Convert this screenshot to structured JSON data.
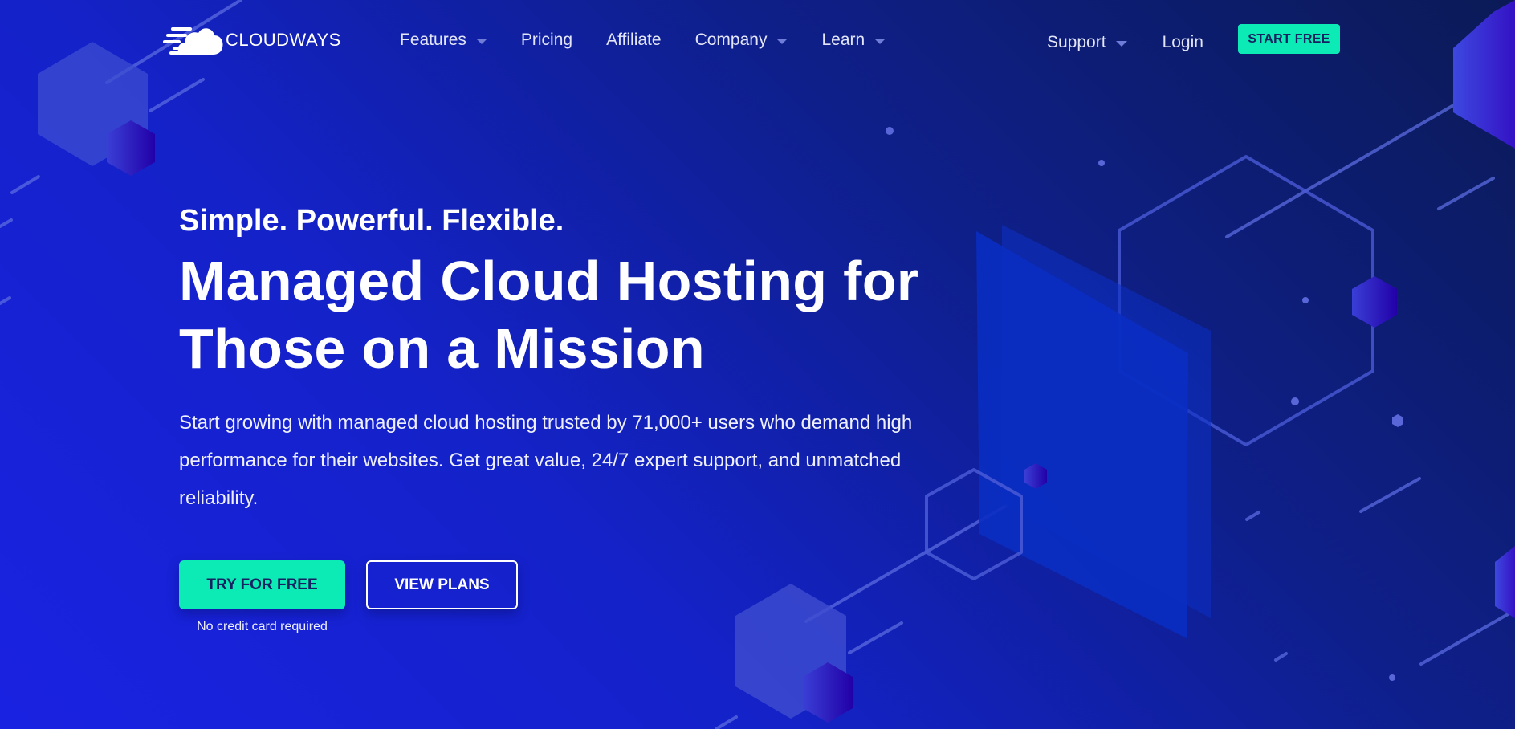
{
  "brand": {
    "name": "CLOUDWAYS",
    "logo_icon": "cloud-speed-icon"
  },
  "nav": {
    "left": [
      {
        "label": "Features",
        "has_dropdown": true
      },
      {
        "label": "Pricing",
        "has_dropdown": false
      },
      {
        "label": "Affiliate",
        "has_dropdown": false
      },
      {
        "label": "Company",
        "has_dropdown": true
      },
      {
        "label": "Learn",
        "has_dropdown": true
      }
    ],
    "right": [
      {
        "label": "Support",
        "has_dropdown": true
      },
      {
        "label": "Login",
        "has_dropdown": false
      }
    ],
    "start_free_label": "START FREE"
  },
  "hero": {
    "tagline": "Simple. Powerful. Flexible.",
    "headline_line1": "Managed Cloud Hosting for",
    "headline_line2": "Those on a Mission",
    "description": "Start growing with managed cloud hosting trusted by 71,000+ users who demand high performance for their websites. Get great value, 24/7 expert support, and unmatched reliability.",
    "primary_cta": "TRY FOR FREE",
    "secondary_cta": "VIEW PLANS",
    "note": "No credit card required"
  },
  "colors": {
    "accent": "#0ceab5",
    "accent_text": "#172161",
    "bg_dark": "#0b1a56",
    "bg_light": "#1a22e2"
  }
}
